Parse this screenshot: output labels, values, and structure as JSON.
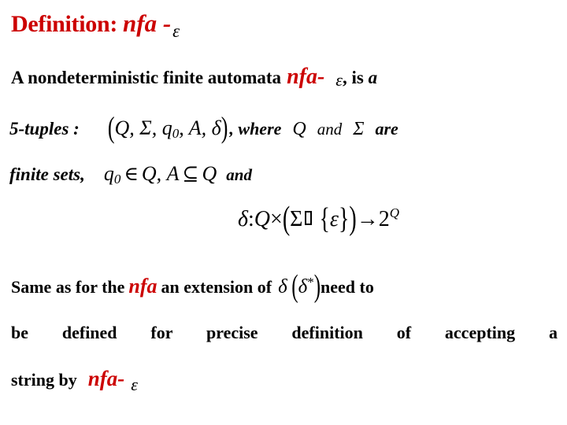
{
  "slide": {
    "background_color": "#ffffff",
    "accent_color": "#cc0000",
    "text_color": "#000000",
    "title": {
      "definition_label": "Definition:",
      "nfa_label": "nfa -",
      "epsilon": "ε"
    },
    "line2": {
      "lead": "A nondeterministic finite automata",
      "nfa_label": "nfa-",
      "epsilon": "ε",
      "tail": ", is",
      "article": "a"
    },
    "line3": {
      "label": "5-tuples :",
      "open_paren": "(",
      "tuple": "Q, Σ, q",
      "subscript": "0",
      "tuple_rest": ", A, δ",
      "close_paren": ")",
      "comma_where": ", where",
      "symbol_q": "Q",
      "and": "and",
      "symbol_sigma": "Σ",
      "are": "are"
    },
    "line4": {
      "label": "finite sets,",
      "q": "q",
      "subscript": "0",
      "element_of": "∈",
      "q_set": "Q,",
      "a_set": "A",
      "subset_of": "⊆",
      "q_set2": "Q",
      "and": "and"
    },
    "formula": {
      "delta": "δ",
      "colon": ":",
      "domain_q": "Q",
      "times": "×",
      "open_paren": "(",
      "sigma": "Σ",
      "missing_glyph": "□",
      "open_brace": "{",
      "epsilon": "ε",
      "close_brace": "}",
      "close_paren": ")",
      "arrow": "→",
      "two": "2",
      "superscript_q": "Q"
    },
    "line6": {
      "lead": "Same as for the",
      "nfa_label": "nfa",
      "mid": "an extension of",
      "delta": "δ",
      "open_paren": "(",
      "delta_star": "δ",
      "star": "*",
      "close_paren": ")",
      "tail": "need to"
    },
    "line7": {
      "text": "be defined for precise definition of accepting a"
    },
    "line8": {
      "lead": "string by",
      "nfa_label": "nfa-",
      "epsilon": "ε"
    }
  }
}
